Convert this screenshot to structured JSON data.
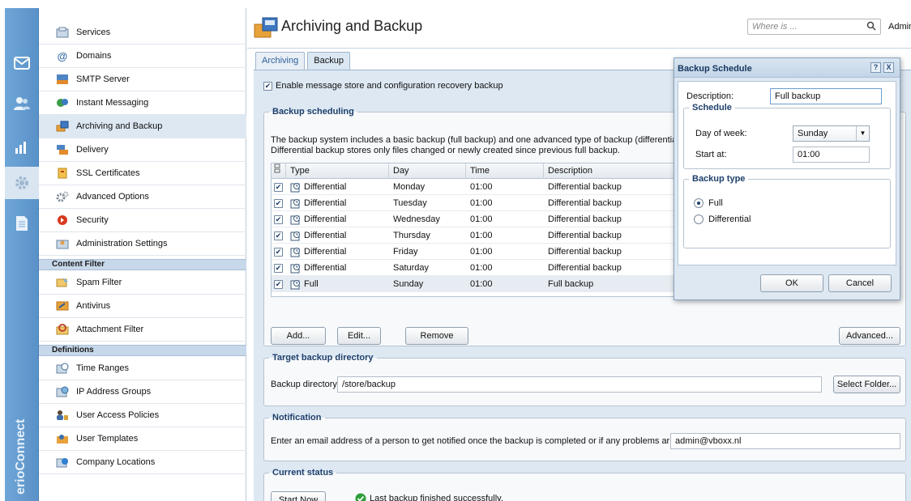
{
  "brand": "erioConnect",
  "nav": {
    "items_top": [
      {
        "label": "Services",
        "icon": "services-icon"
      },
      {
        "label": "Domains",
        "icon": "domains-icon"
      },
      {
        "label": "SMTP Server",
        "icon": "smtp-server-icon"
      },
      {
        "label": "Instant Messaging",
        "icon": "instant-messaging-icon"
      },
      {
        "label": "Archiving and Backup",
        "icon": "archiving-backup-icon",
        "selected": true
      },
      {
        "label": "Delivery",
        "icon": "delivery-icon"
      },
      {
        "label": "SSL Certificates",
        "icon": "ssl-certificates-icon"
      },
      {
        "label": "Advanced Options",
        "icon": "advanced-options-icon"
      },
      {
        "label": "Security",
        "icon": "security-icon"
      },
      {
        "label": "Administration Settings",
        "icon": "administration-settings-icon"
      }
    ],
    "section_content_filter": "Content Filter",
    "items_content_filter": [
      {
        "label": "Spam Filter",
        "icon": "spam-filter-icon"
      },
      {
        "label": "Antivirus",
        "icon": "antivirus-icon"
      },
      {
        "label": "Attachment Filter",
        "icon": "attachment-filter-icon"
      }
    ],
    "section_definitions": "Definitions",
    "items_definitions": [
      {
        "label": "Time Ranges",
        "icon": "time-ranges-icon"
      },
      {
        "label": "IP Address Groups",
        "icon": "ip-address-groups-icon"
      },
      {
        "label": "User Access Policies",
        "icon": "user-access-policies-icon"
      },
      {
        "label": "User Templates",
        "icon": "user-templates-icon"
      },
      {
        "label": "Company Locations",
        "icon": "company-locations-icon"
      }
    ]
  },
  "header": {
    "title": "Archiving and Backup",
    "search_placeholder": "Where is ...",
    "user": "Admin"
  },
  "tabs": [
    {
      "label": "Archiving",
      "active": false
    },
    {
      "label": "Backup",
      "active": true
    }
  ],
  "backup": {
    "enable_label": "Enable message store and configuration recovery backup",
    "enable_checked": true,
    "scheduling_legend": "Backup scheduling",
    "description_line1": "The backup system includes a basic backup (full backup) and one advanced type of backup (differential).",
    "description_line2": "Differential backup stores only files changed or newly created since previous full backup.",
    "columns": {
      "type": "Type",
      "day": "Day",
      "time": "Time",
      "description": "Description"
    },
    "rows": [
      {
        "type": "Differential",
        "day": "Monday",
        "time": "01:00",
        "description": "Differential backup"
      },
      {
        "type": "Differential",
        "day": "Tuesday",
        "time": "01:00",
        "description": "Differential backup"
      },
      {
        "type": "Differential",
        "day": "Wednesday",
        "time": "01:00",
        "description": "Differential backup"
      },
      {
        "type": "Differential",
        "day": "Thursday",
        "time": "01:00",
        "description": "Differential backup"
      },
      {
        "type": "Differential",
        "day": "Friday",
        "time": "01:00",
        "description": "Differential backup"
      },
      {
        "type": "Differential",
        "day": "Saturday",
        "time": "01:00",
        "description": "Differential backup"
      },
      {
        "type": "Full",
        "day": "Sunday",
        "time": "01:00",
        "description": "Full backup"
      }
    ],
    "buttons": {
      "add": "Add...",
      "edit": "Edit...",
      "remove": "Remove",
      "advanced": "Advanced..."
    },
    "target_legend": "Target backup directory",
    "directory_label": "Backup directory:",
    "directory_value": "/store/backup",
    "select_folder": "Select Folder...",
    "notification_legend": "Notification",
    "notification_label": "Enter an email address of a person to get notified once the backup is completed or if any problems arise:",
    "notification_value": "admin@vboxx.nl",
    "status_legend": "Current status",
    "start_now": "Start Now",
    "status_text": "Last backup finished successfully."
  },
  "dialog": {
    "title": "Backup Schedule",
    "help": "?",
    "close": "X",
    "description_label": "Description:",
    "description_value": "Full backup",
    "schedule_legend": "Schedule",
    "day_label": "Day of week:",
    "day_value": "Sunday",
    "start_label": "Start at:",
    "start_value": "01:00",
    "type_legend": "Backup type",
    "option_full": "Full",
    "option_differential": "Differential",
    "selected_type": "Full",
    "ok": "OK",
    "cancel": "Cancel"
  },
  "colors": {
    "rail": "#5f97cc",
    "selection": "#dde8f3",
    "legend": "#1e3f6b",
    "success": "#2e9e3a"
  }
}
